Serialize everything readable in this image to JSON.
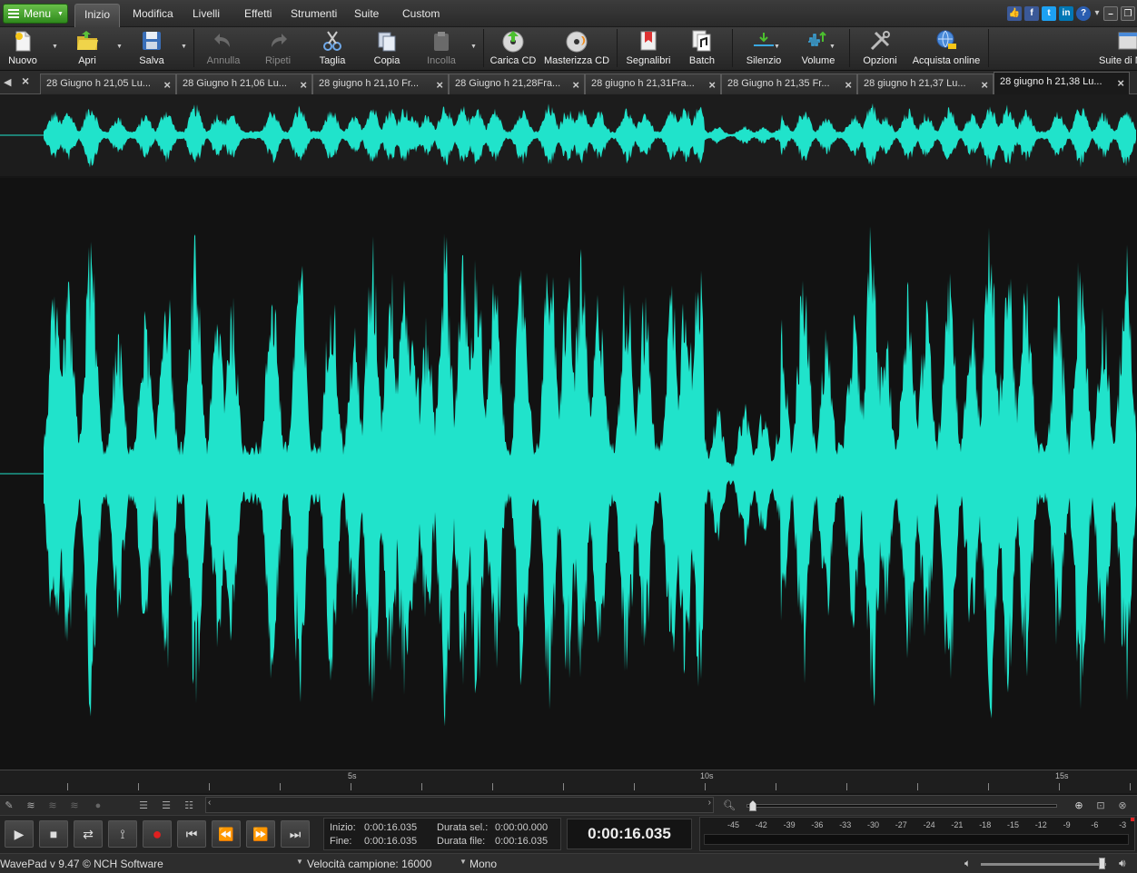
{
  "menubar": {
    "menu_label": "Menu",
    "tabs": [
      "Inizio",
      "Modifica",
      "Livelli",
      "Effetti",
      "Strumenti",
      "Suite",
      "Custom"
    ],
    "active_tab": "Inizio"
  },
  "toolbar": {
    "nuovo": "Nuovo",
    "apri": "Apri",
    "salva": "Salva",
    "annulla": "Annulla",
    "ripeti": "Ripeti",
    "taglia": "Taglia",
    "copia": "Copia",
    "incolla": "Incolla",
    "carica_cd": "Carica CD",
    "masterizza_cd": "Masterizza CD",
    "segnalibri": "Segnalibri",
    "batch": "Batch",
    "silenzio": "Silenzio",
    "volume": "Volume",
    "opzioni": "Opzioni",
    "acquista": "Acquista online",
    "suite": "Suite di N"
  },
  "file_tabs": [
    "28 Giugno h 21,05 Lu...",
    "28 Giugno h 21,06 Lu...",
    "28 giugno h 21,10 Fr...",
    "28 Giugno h 21,28Fra...",
    "28 giugno h 21,31Fra...",
    "28 Giugno h 21,35 Fr...",
    "28 giugno h 21,37 Lu...",
    "28 giugno h 21,38 Lu..."
  ],
  "ruler": {
    "labels": [
      "5s",
      "10s",
      "15s"
    ]
  },
  "info": {
    "inizio_label": "Inizio:",
    "inizio_value": "0:00:16.035",
    "fine_label": "Fine:",
    "fine_value": "0:00:16.035",
    "durata_sel_label": "Durata sel.:",
    "durata_sel_value": "0:00:00.000",
    "durata_file_label": "Durata file:",
    "durata_file_value": "0:00:16.035"
  },
  "current_time": "0:00:16.035",
  "meter_labels": [
    "-45",
    "-42",
    "-39",
    "-36",
    "-33",
    "-30",
    "-27",
    "-24",
    "-21",
    "-18",
    "-15",
    "-12",
    "-9",
    "-6",
    "-3"
  ],
  "status": {
    "app": "WavePad v 9.47 © NCH Software",
    "rate": "Velocità campione: 16000",
    "channels": "Mono"
  },
  "colors": {
    "waveform": "#20e3cb",
    "accent_green": "#4caf2f"
  }
}
